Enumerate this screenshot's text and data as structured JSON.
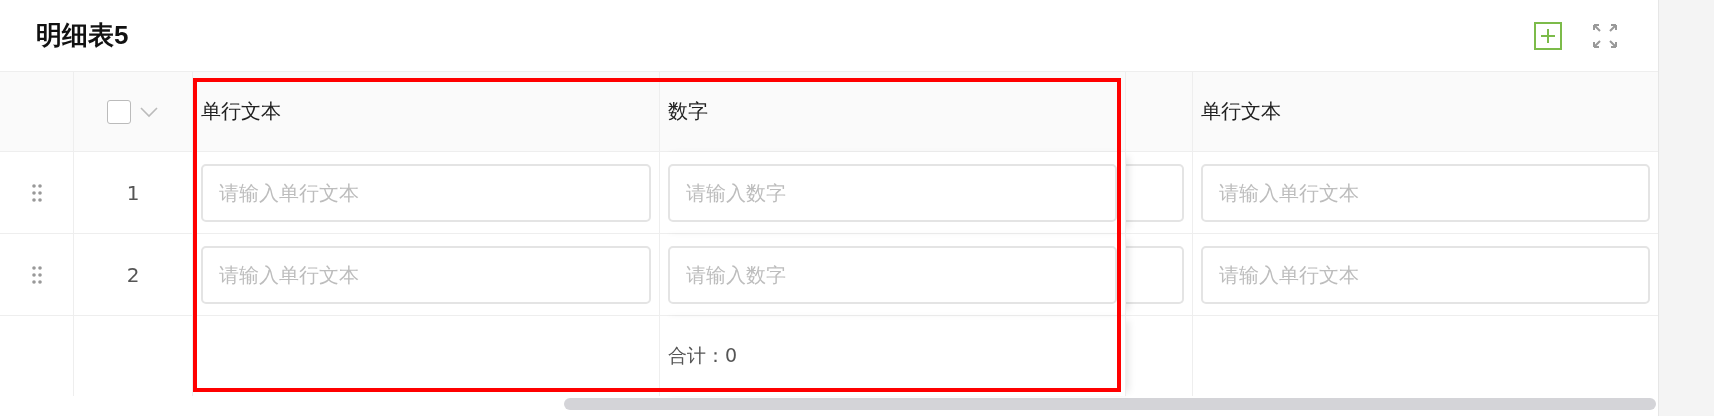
{
  "title": "明细表5",
  "table": {
    "select_all": {
      "checked": false
    },
    "columns": [
      {
        "label": "单行文本"
      },
      {
        "label": "数字",
        "total": "合计：0"
      },
      {
        "label": "单行文本"
      }
    ],
    "rows": [
      {
        "index": "1",
        "cells": [
          {
            "placeholder": "请输入单行文本"
          },
          {
            "placeholder": "请输入数字"
          },
          {
            "placeholder": "请输入单行文本"
          }
        ]
      },
      {
        "index": "2",
        "cells": [
          {
            "placeholder": "请输入单行文本"
          },
          {
            "placeholder": "请输入数字"
          },
          {
            "placeholder": "请输入单行文本"
          }
        ]
      }
    ]
  }
}
